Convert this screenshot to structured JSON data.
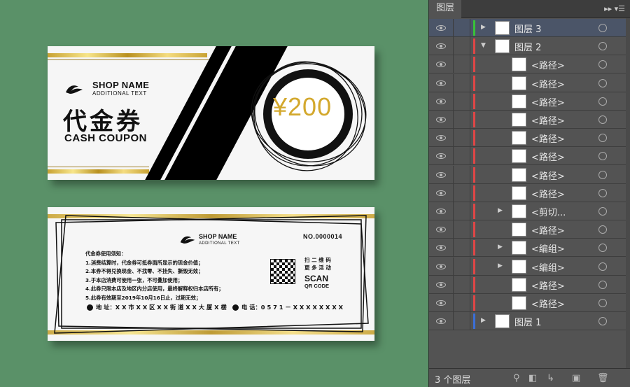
{
  "front": {
    "shop_name": "SHOP NAME",
    "additional_text": "ADDITIONAL TEXT",
    "title_cn": "代金券",
    "title_en": "CASH COUPON",
    "price": "¥200"
  },
  "back": {
    "shop_name": "SHOP NAME",
    "additional_text": "ADDITIONAL TEXT",
    "number": "NO.0000014",
    "rules_title": "代金券使用须知：",
    "rules": [
      "1.消费结算时，代金券可抵券面所显示的现金价值；",
      "2.本券不得兑换现金、不找零、不挂失、撕毁无效；",
      "3.于本店消费可使用一张，不可叠加使用；",
      "4.此券只限本店及地区内分店使用，最终解释权归本店所有；",
      "5.此券有效期至2019年10月16日止，过期无效；"
    ],
    "address": "地 址：X X 市 X X 区 X X 街 道 X X 大 厦 X 楼",
    "phone": "电 话：0 5 7 1 － X X X X X X X X",
    "scan_cn_1": "扫 二 维 码",
    "scan_cn_2": "更 多 活 动",
    "scan": "SCAN",
    "qr_code": "QR CODE"
  },
  "panel": {
    "tab": "图层",
    "menu_icon": "panel-menu-icon",
    "layers": [
      {
        "name": "图层 3",
        "expanded": false,
        "color": "#38c338",
        "selected": true
      },
      {
        "name": "图层 2",
        "expanded": true,
        "color": "#e04646",
        "selected": false
      },
      {
        "name": "<路径>",
        "color": "#e04646"
      },
      {
        "name": "<路径>",
        "color": "#e04646"
      },
      {
        "name": "<路径>",
        "color": "#e04646"
      },
      {
        "name": "<路径>",
        "color": "#e04646"
      },
      {
        "name": "<路径>",
        "color": "#e04646"
      },
      {
        "name": "<路径>",
        "color": "#e04646"
      },
      {
        "name": "<路径>",
        "color": "#e04646"
      },
      {
        "name": "<路径>",
        "color": "#e04646"
      },
      {
        "name": "<剪切...",
        "color": "#e04646",
        "group": true
      },
      {
        "name": "<路径>",
        "color": "#e04646"
      },
      {
        "name": "<编组>",
        "color": "#e04646",
        "group": true
      },
      {
        "name": "<编组>",
        "color": "#e04646",
        "group": true
      },
      {
        "name": "<路径>",
        "color": "#e04646"
      },
      {
        "name": "<路径>",
        "color": "#e04646"
      },
      {
        "name": "图层 1",
        "expanded": false,
        "color": "#3b6fd8",
        "selected": false
      }
    ],
    "footer_count": "3 个图层"
  }
}
